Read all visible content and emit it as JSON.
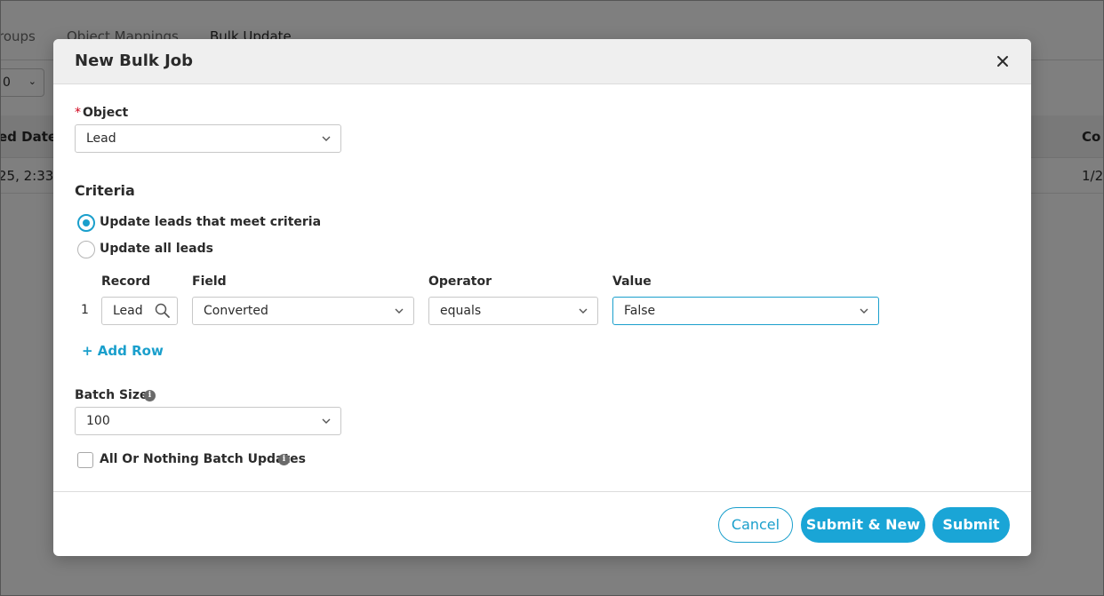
{
  "background": {
    "tabs": [
      "roups",
      "Object Mappings",
      "Bulk Update"
    ],
    "select_value": "0",
    "table": {
      "headers": [
        "ed Date",
        "Co"
      ],
      "row": [
        "25, 2:33",
        "1/2"
      ]
    }
  },
  "modal": {
    "title": "New Bulk Job",
    "object": {
      "required_mark": "*",
      "label": "Object",
      "value": "Lead"
    },
    "criteria": {
      "title": "Criteria",
      "options": [
        {
          "label": "Update leads that meet criteria",
          "checked": true
        },
        {
          "label": "Update all leads",
          "checked": false
        }
      ],
      "columns": {
        "record": "Record",
        "field": "Field",
        "operator": "Operator",
        "value": "Value"
      },
      "rows": [
        {
          "num": "1",
          "record": "Lead",
          "field": "Converted",
          "operator": "equals",
          "value": "False"
        }
      ],
      "add_row": "+ Add Row"
    },
    "batch_size": {
      "label": "Batch Size",
      "value": "100"
    },
    "all_or_nothing": {
      "label": "All Or Nothing Batch Updates",
      "checked": false
    },
    "buttons": {
      "cancel": "Cancel",
      "submit_new": "Submit & New",
      "submit": "Submit"
    }
  },
  "colors": {
    "accent": "#1a9fcc",
    "primary_button": "#1aa5d6",
    "required": "#d0021b"
  },
  "icons": {
    "close": "close-icon",
    "chevron": "chevron-down-icon",
    "search": "search-icon",
    "info": "info-icon"
  }
}
